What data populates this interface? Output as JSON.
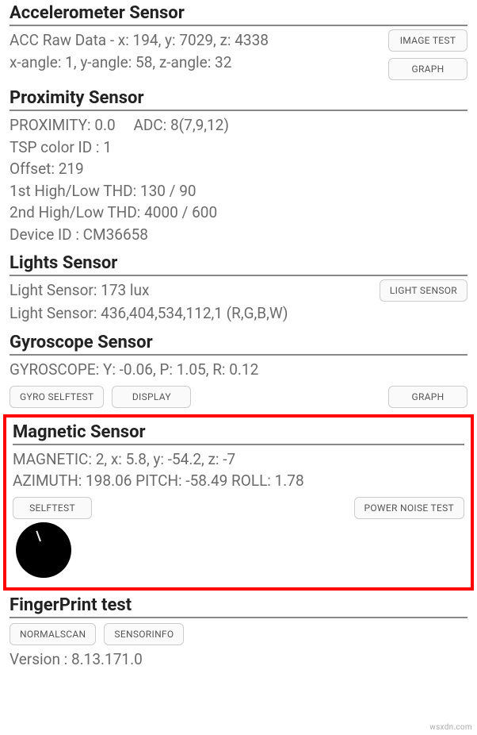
{
  "accelerometer": {
    "title": "Accelerometer Sensor",
    "line1": "ACC Raw Data - x: 194, y: 7029, z: 4338",
    "line2": "x-angle: 1, y-angle: 58, z-angle: 32",
    "buttons": {
      "image_test": "IMAGE TEST",
      "graph": "GRAPH"
    }
  },
  "proximity": {
    "title": "Proximity Sensor",
    "line1a": "PROXIMITY: 0.0",
    "line1b": "ADC: 8(7,9,12)",
    "line2": "TSP color ID : 1",
    "line3": "Offset: 219",
    "line4": "1st High/Low THD: 130 / 90",
    "line5": "2nd High/Low THD: 4000 / 600",
    "line6": "Device ID : CM36658"
  },
  "lights": {
    "title": "Lights Sensor",
    "line1": "Light Sensor: 173 lux",
    "line2": "Light Sensor: 436,404,534,112,1 (R,G,B,W)",
    "buttons": {
      "light_sensor": "LIGHT SENSOR"
    }
  },
  "gyroscope": {
    "title": "Gyroscope Sensor",
    "line1": "GYROSCOPE: Y: -0.06, P: 1.05, R: 0.12",
    "buttons": {
      "selftest": "GYRO SELFTEST",
      "display": "DISPLAY",
      "graph": "GRAPH"
    }
  },
  "magnetic": {
    "title": "Magnetic Sensor",
    "line1": "MAGNETIC: 2, x: 5.8, y: -54.2, z: -7",
    "line2": "AZIMUTH: 198.06   PITCH: -58.49   ROLL: 1.78",
    "buttons": {
      "selftest": "SELFTEST",
      "power_noise": "POWER NOISE TEST"
    }
  },
  "fingerprint": {
    "title": "FingerPrint test",
    "buttons": {
      "normalscan": "NORMALSCAN",
      "sensorinfo": "SENSORINFO"
    },
    "version_line": "Version : 8.13.171.0"
  },
  "watermark": "wsxdn.com"
}
